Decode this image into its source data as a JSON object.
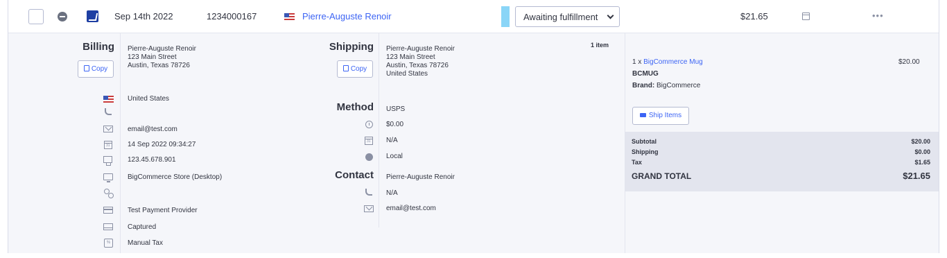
{
  "order": {
    "date": "Sep 14th 2022",
    "id": "1234000167",
    "customer_name": "Pierre-Auguste Renoir",
    "status": "Awaiting fulfillment",
    "total": "$21.65",
    "icons": {
      "select": "checkbox-icon",
      "collapse": "minus-circle-icon",
      "store": "bigcommerce-store-icon",
      "flag": "us-flag-icon",
      "calendar": "calendar-icon",
      "more": "more-actions-icon"
    }
  },
  "billing": {
    "heading": "Billing",
    "copy_label": "Copy",
    "address": "Pierre-Auguste Renoir\n123 Main Street\nAustin, Texas 78726",
    "country": "United States",
    "phone": "",
    "email": "email@test.com",
    "date_time": "14 Sep 2022 09:34:27",
    "ip": "123.45.678.901",
    "channel": "BigCommerce Store (Desktop)",
    "payment_provider": "Test Payment Provider",
    "payment_status": "Captured",
    "tax": "Manual Tax"
  },
  "shipping": {
    "heading": "Shipping",
    "copy_label": "Copy",
    "address": "Pierre-Auguste Renoir\n123 Main Street\nAustin, Texas 78726\nUnited States",
    "method_heading": "Method",
    "method": "USPS",
    "cost": "$0.00",
    "date": "N/A",
    "zone": "Local",
    "contact_heading": "Contact",
    "contact_name": "Pierre-Auguste Renoir",
    "contact_phone": "N/A",
    "contact_email": "email@test.com"
  },
  "items": {
    "count_label": "1 item",
    "lines": [
      {
        "qty": "1 x ",
        "name": "BigCommerce Mug",
        "sku": "BCMUG",
        "brand_label": "Brand:",
        "brand": " BigCommerce",
        "price": "$20.00"
      }
    ],
    "ship_button": "Ship Items"
  },
  "summary": {
    "subtotal_label": "Subtotal",
    "subtotal": "$20.00",
    "shipping_label": "Shipping",
    "shipping": "$0.00",
    "tax_label": "Tax",
    "tax": "$1.65",
    "grand_total_label": "GRAND TOTAL",
    "grand_total": "$21.65"
  },
  "colors": {
    "accent": "#3c64f4",
    "status_indicator": "#8ad5f7",
    "text": "#313440",
    "summary_bg": "#e3e5ee"
  }
}
